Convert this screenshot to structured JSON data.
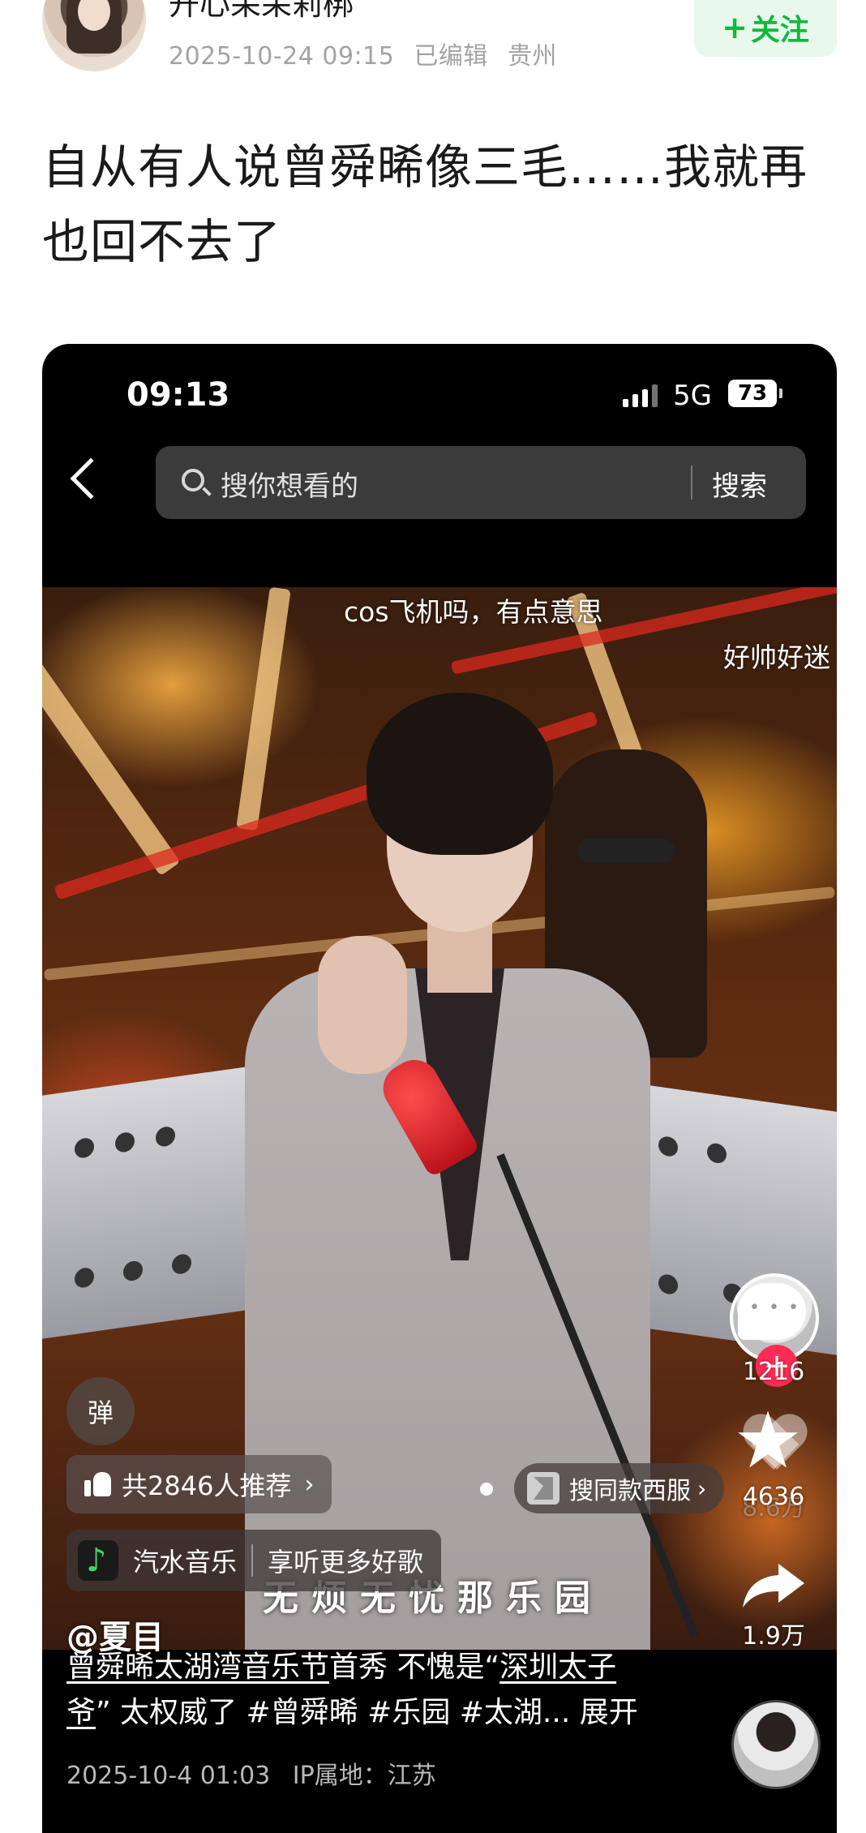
{
  "post": {
    "author_name": "开心呆呆莉梆",
    "date": "2025-10-24 09:15",
    "edited": "已编辑",
    "location": "贵州",
    "follow_label": "关注",
    "title": "自从有人说曾舜晞像三毛……我就再也回不去了"
  },
  "phone": {
    "time": "09:13",
    "network": "5G",
    "battery": "73",
    "search_placeholder": "搜你想看的",
    "search_button": "搜索"
  },
  "video": {
    "danmu": [
      "cos飞机吗，有点意思",
      "好帅好迷"
    ],
    "lyric": "无烦无忧那乐园",
    "shop_label": "搜同款西服",
    "danmaku_toggle": "弹",
    "recommend": "共2846人推荐",
    "music_app": "汽水音乐",
    "music_cta": "享听更多好歌",
    "author_tag": "@夏目"
  },
  "rail": {
    "likes": "8.6万",
    "comments": "1216",
    "favorites": "4636",
    "shares": "1.9万"
  },
  "caption": {
    "line1_underlined": "曾舜晞太湖湾音乐节",
    "line1_rest": "首秀 不愧是“",
    "line1_underlined2": "深圳太子",
    "line2_underlined": "爷",
    "line2_rest": "” 太权威了 #曾舜晞 #乐园 #太湖... 展开",
    "date": "2025-10-4 01:03",
    "ip": "IP属地：江苏"
  },
  "colors": {
    "follow_green": "#12b83c",
    "follow_bg": "#e9f8ec",
    "plus_red": "#fe2c55",
    "music_green": "#3fd46a"
  }
}
